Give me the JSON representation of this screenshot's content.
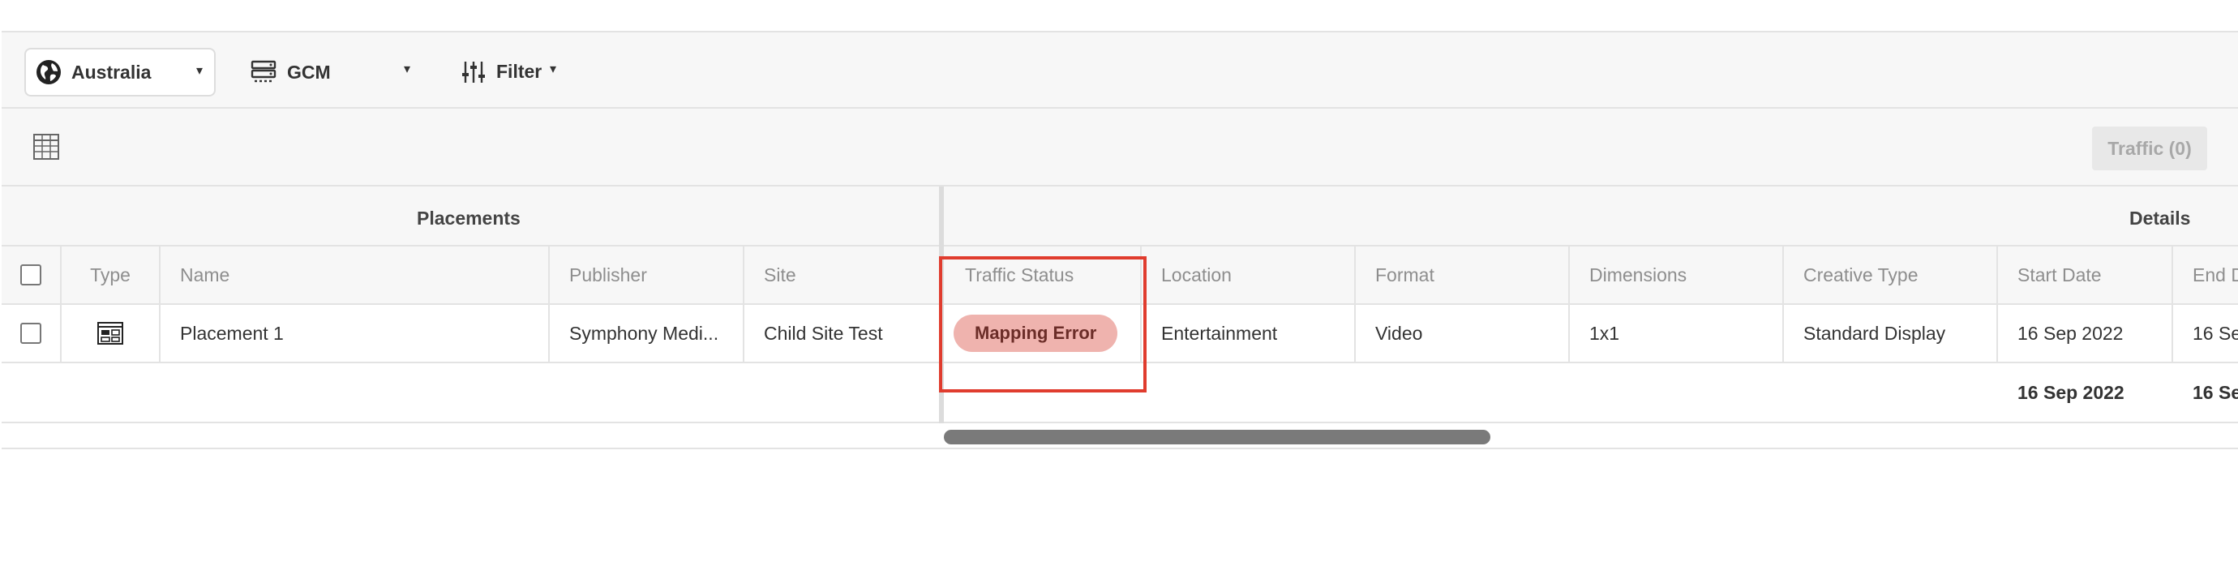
{
  "toolbar": {
    "region": "Australia",
    "adserver": "GCM",
    "filter_label": "Filter",
    "caret": "▾"
  },
  "subbar": {
    "grid_icon": "grid-icon",
    "traffic_button": "Traffic (0)"
  },
  "table": {
    "groups": {
      "placements": "Placements",
      "details": "Details"
    },
    "headers": {
      "type": "Type",
      "name": "Name",
      "publisher": "Publisher",
      "site": "Site",
      "traffic_status": "Traffic Status",
      "location": "Location",
      "format": "Format",
      "dimensions": "Dimensions",
      "creative_type": "Creative Type",
      "start_date": "Start Date",
      "end_date": "End D"
    },
    "rows": [
      {
        "type_icon": "display-placement-icon",
        "name": "Placement 1",
        "publisher": "Symphony Medi...",
        "site": "Child Site Test",
        "traffic_status": "Mapping Error",
        "location": "Entertainment",
        "format": "Video",
        "dimensions": "1x1",
        "creative_type": "Standard Display",
        "start_date": "16 Sep 2022",
        "end_date": "16 Se"
      }
    ],
    "totals": {
      "start_date": "16 Sep 2022",
      "end_date": "16 Se"
    }
  },
  "colors": {
    "status_error_bg": "#efb3ae",
    "highlight_border": "#e03c2e"
  }
}
